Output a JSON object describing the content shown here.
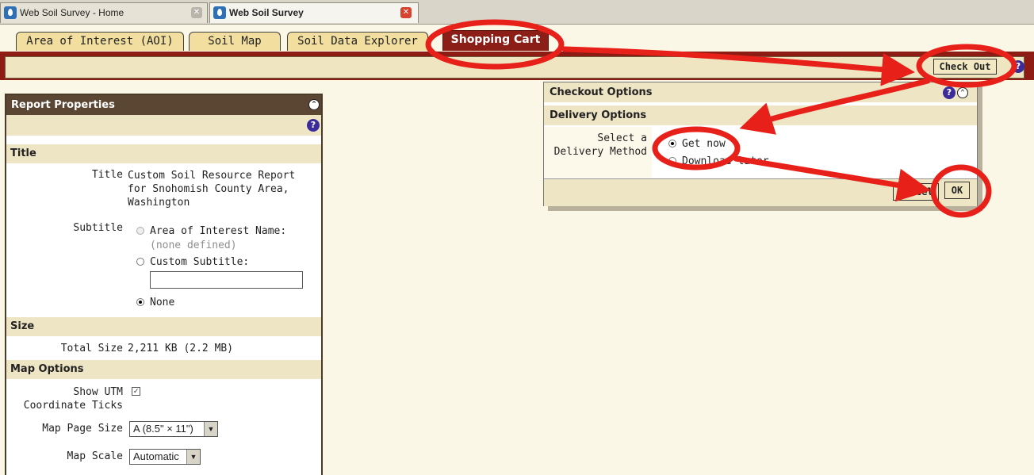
{
  "browser": {
    "tabs": [
      {
        "label": "Web Soil Survey - Home"
      },
      {
        "label": "Web Soil Survey"
      }
    ]
  },
  "app_tabs": [
    "Area of Interest (AOI)",
    "Soil Map",
    "Soil Data Explorer",
    "Shopping Cart"
  ],
  "toolbar": {
    "checkout_label": "Check Out"
  },
  "report": {
    "header": "Report Properties",
    "title_section": "Title",
    "title_label": "Title",
    "title_value": "Custom Soil Resource Report for Snohomish County Area, Washington",
    "subtitle_label": "Subtitle",
    "subtitle_opt1": "Area of Interest Name:",
    "subtitle_opt1_note": "(none defined)",
    "subtitle_opt2": "Custom Subtitle:",
    "subtitle_custom_value": "",
    "subtitle_opt3": "None",
    "subtitle_selected": "None",
    "size_section": "Size",
    "total_size_label": "Total Size",
    "total_size_value": "2,211 KB (2.2 MB)",
    "map_section": "Map Options",
    "utm_label": "Show UTM Coordinate Ticks",
    "utm_checked": true,
    "page_size_label": "Map Page Size",
    "page_size_value": "A (8.5\" × 11\")",
    "scale_label": "Map Scale",
    "scale_value": "Automatic"
  },
  "checkout": {
    "header": "Checkout Options",
    "delivery_header": "Delivery Options",
    "method_label": "Select a Delivery Method",
    "opt_now": "Get now",
    "opt_later": "Download later",
    "selected": "Get now",
    "cancel_label": "Cancel",
    "ok_label": "OK"
  },
  "colors": {
    "accent": "#8b1e16",
    "header_brown": "#5a4632",
    "section_bg": "#eee5c5",
    "annotation_red": "#e8201a"
  }
}
